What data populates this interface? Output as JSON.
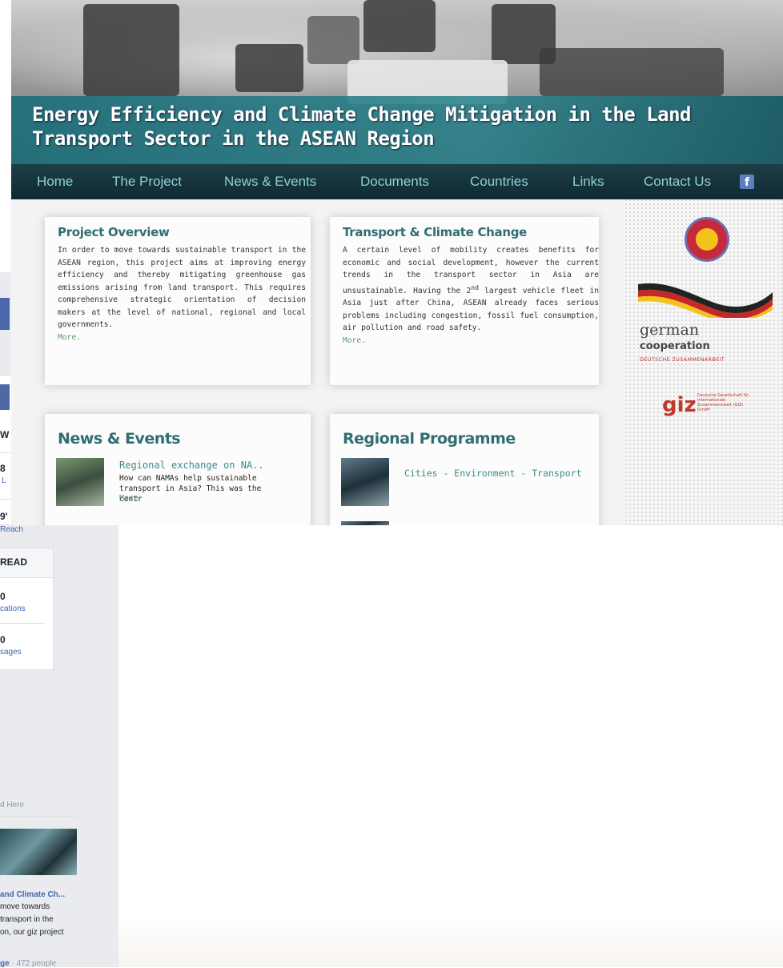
{
  "site": {
    "title": "Energy Efficiency and Climate Change Mitigation in the Land Transport Sector in the ASEAN Region",
    "nav": [
      "Home",
      "The Project",
      "News & Events",
      "Documents",
      "Countries",
      "Links",
      "Contact Us"
    ],
    "facebook_glyph": "f",
    "project_overview": {
      "heading": "Project Overview",
      "body": "In order to move towards sustainable transport in the ASEAN region, this project aims at improving energy efficiency and thereby mitigating greenhouse gas emissions arising from land transport. This requires comprehensive strategic orientation of decision makers at the level of national, regional and local governments.",
      "more": "More."
    },
    "transport_climate": {
      "heading": "Transport & Climate Change",
      "body_before": "A certain level of mobility creates benefits for economic and social development, however the current trends in the transport sector in Asia are unsustainable. Having the 2",
      "superscript": "nd",
      "body_after": " largest vehicle fleet in Asia just after China, ASEAN already faces serious problems including congestion, fossil fuel consumption, air pollution and road safety.",
      "more": "More."
    },
    "news_events": {
      "heading": "News & Events",
      "item_title": "Regional exchange on NA..",
      "item_desc": "How can NAMAs help sustainable transport in Asia?  This was the centr",
      "more": "More"
    },
    "regional_programme": {
      "heading": "Regional Programme",
      "item_title": "Cities - Environment - Transport"
    },
    "sidebar": {
      "german": "german",
      "cooperation": "cooperation",
      "deutsche": "DEUTSCHE ZUSAMMENARBEIT",
      "giz": "giz",
      "giz_small": "Deutsche Gesellschaft für Internationale Zusammenarbeit (GIZ) GmbH"
    }
  },
  "background_fb": {
    "row1_letter": "W",
    "row2_num": "8",
    "row2_sub": "L",
    "row3_num": "9'",
    "row3_sub": "Reach",
    "read": "READ",
    "notif_num": "0",
    "notif_label": "cations",
    "msg_num": "0",
    "msg_label": "sages",
    "section_label": "d Here",
    "post_title": "and Climate Ch...",
    "post_line1": "move towards",
    "post_line2": "transport in the",
    "post_line3": "on, our giz project",
    "footer_bold": "ge",
    "footer_rest": " · 472 people"
  },
  "colors": {
    "teal_heading": "#2f6e72",
    "nav_text": "#8fd0d6",
    "nav_bg": "#0f2a32",
    "more_link": "#5f9b6c",
    "giz_red": "#c0392b"
  }
}
